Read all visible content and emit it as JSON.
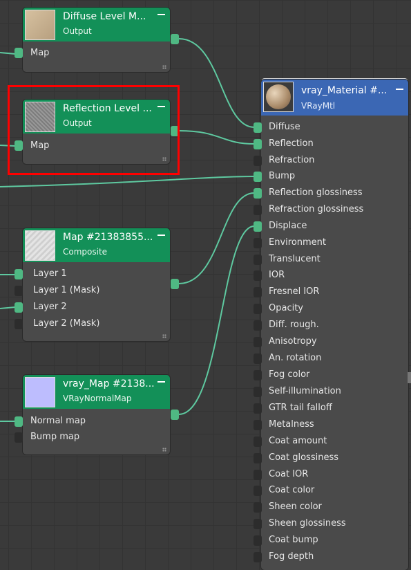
{
  "nodes": {
    "diffuse": {
      "title": "Diffuse Level M...",
      "subtitle": "Output",
      "inputs": [
        "Map"
      ],
      "thumb_color": "#c9b293"
    },
    "reflection": {
      "title": "Reflection Level ...",
      "subtitle": "Output",
      "inputs": [
        "Map"
      ],
      "thumb_color": "#8e8e8e"
    },
    "composite": {
      "title": "Map #21383855...",
      "subtitle": "Composite",
      "inputs": [
        "Layer 1",
        "Layer 1 (Mask)",
        "Layer 2",
        "Layer 2 (Mask)"
      ],
      "thumb_color": "#d9d9d9"
    },
    "normal": {
      "title": "vray_Map #2138...",
      "subtitle": "VRayNormalMap",
      "inputs": [
        "Normal map",
        "Bump map"
      ],
      "thumb_color": "#bdbdfe"
    },
    "material": {
      "title": "vray_Material #...",
      "subtitle": "VRayMtl",
      "thumb_color": "#b89a7a",
      "inputs": [
        "Diffuse",
        "Reflection",
        "Refraction",
        "Bump",
        "Reflection glossiness",
        "Refraction glossiness",
        "Displace",
        "Environment",
        "Translucent",
        "IOR",
        "Fresnel IOR",
        "Opacity",
        "Diff. rough.",
        "Anisotropy",
        "An. rotation",
        "Fog color",
        "Self-illumination",
        "GTR tail falloff",
        "Metalness",
        "Coat amount",
        "Coat glossiness",
        "Coat IOR",
        "Coat color",
        "Sheen color",
        "Sheen glossiness",
        "Coat bump",
        "Fog depth"
      ]
    }
  },
  "colors": {
    "node_green": "#139058",
    "node_blue": "#3b67b4",
    "wire": "#5ec9a0",
    "selection": "#ff0000"
  }
}
